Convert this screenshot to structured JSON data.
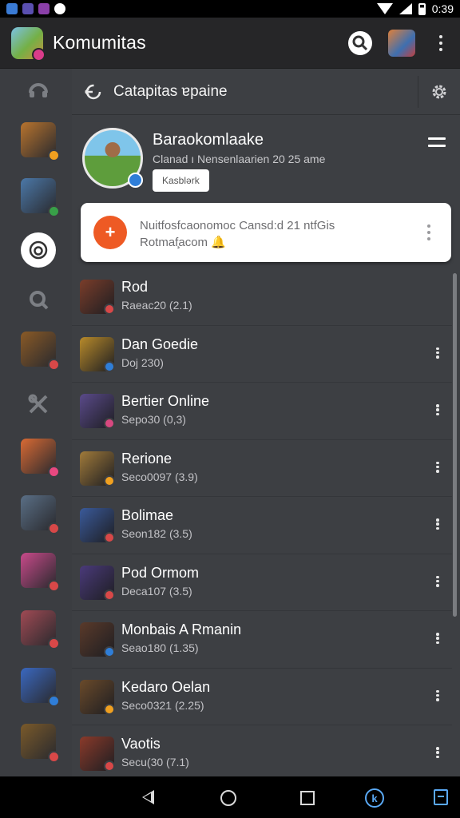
{
  "status_bar": {
    "time": "0:39",
    "icons": [
      "app-notification-icon",
      "game-notification-icon",
      "store-notification-icon",
      "cloud-icon",
      "wifi-icon",
      "signal-icon",
      "battery-icon"
    ]
  },
  "app_bar": {
    "title": "Komumitas",
    "icons": [
      "app-logo",
      "search-icon",
      "profile-thumbnail",
      "more-icon"
    ]
  },
  "subheader": {
    "title": "Catapitas ɐpaine",
    "icons": [
      "back-icon",
      "settings-icon"
    ]
  },
  "profile": {
    "name": "Baraokomlaake",
    "subtitle": "Clanad ı Nensenlaarien 20 25 ame",
    "button_label": "Kasblərk"
  },
  "notice": {
    "text_line1": "Nuitfosfcaonomoc Cansd:d 21 ntfGis",
    "text_line2": "Rotmaf̧acom 🔔",
    "icon_glyph": "+"
  },
  "rail": {
    "items": [
      {
        "icon": "headset-icon",
        "kind": "icon"
      },
      {
        "icon": "game-thumbnail",
        "kind": "game",
        "color": "#b8742e",
        "badge": "#f0a020"
      },
      {
        "icon": "game-thumbnail",
        "kind": "game",
        "color": "#4b78a8",
        "badge": "#38a048"
      },
      {
        "icon": "chat-icon",
        "kind": "selected"
      },
      {
        "icon": "search-icon",
        "kind": "icon"
      },
      {
        "icon": "game-thumbnail",
        "kind": "game",
        "color": "#8a5a26",
        "badge": "#d84848"
      },
      {
        "icon": "tools-icon",
        "kind": "icon"
      },
      {
        "icon": "game-thumbnail",
        "kind": "game",
        "color": "#d96a34",
        "badge": "#e84880"
      },
      {
        "icon": "game-thumbnail",
        "kind": "game",
        "color": "#5a6f86",
        "badge": "#d84848"
      },
      {
        "icon": "game-thumbnail",
        "kind": "game",
        "color": "#c84a8a",
        "badge": "#d84848"
      },
      {
        "icon": "game-thumbnail",
        "kind": "game",
        "color": "#a04a54",
        "badge": "#d84848"
      },
      {
        "icon": "game-thumbnail",
        "kind": "game",
        "color": "#3a68c0",
        "badge": "#2f7ed8"
      },
      {
        "icon": "game-thumbnail",
        "kind": "game",
        "color": "#7a5a2a",
        "badge": "#d84848"
      }
    ]
  },
  "list": {
    "rows": [
      {
        "title": "Rod",
        "subtitle": "Raeac20 (2.1)",
        "thumb_color": "#7a3d2a",
        "badge_color": "#d84848",
        "has_menu": false
      },
      {
        "title": "Dan Goedie",
        "subtitle": "Doj 230)",
        "thumb_color": "#b88a2a",
        "badge_color": "#2f7ed8",
        "has_menu": true
      },
      {
        "title": "Bertier Online",
        "subtitle": "Sepo30 (0,3)",
        "thumb_color": "#5a4a8a",
        "badge_color": "#d84880",
        "has_menu": true
      },
      {
        "title": "Rerione",
        "subtitle": "Seco0097 (3.9)",
        "thumb_color": "#a07a3a",
        "badge_color": "#f0a020",
        "has_menu": true
      },
      {
        "title": "Bolimae",
        "subtitle": "Seon182 (3.5)",
        "thumb_color": "#3a5a9a",
        "badge_color": "#d84848",
        "has_menu": true
      },
      {
        "title": "Pod Ormom",
        "subtitle": "Deca107 (3.5)",
        "thumb_color": "#4a3a7a",
        "badge_color": "#d84848",
        "has_menu": true
      },
      {
        "title": "Monbais A Rmanin",
        "subtitle": "Seao180 (1.35)",
        "thumb_color": "#5a3a2a",
        "badge_color": "#2f7ed8",
        "has_menu": true
      },
      {
        "title": "Kedaro Oelan",
        "subtitle": "Seco0321 (2.25)",
        "thumb_color": "#6a4a2a",
        "badge_color": "#f0a020",
        "has_menu": true
      },
      {
        "title": "Vaotis",
        "subtitle": "Secu(30 (7.1)",
        "thumb_color": "#8a3a2a",
        "badge_color": "#d84848",
        "has_menu": true
      }
    ]
  },
  "nav_bar": {
    "icons": [
      "back-triangle-icon",
      "home-circle-icon",
      "recents-square-icon",
      "assistant-icon",
      "share-icon"
    ]
  },
  "colors": {
    "rail_bg": "#3b3d41",
    "main_bg": "#3d3f43",
    "app_bar_bg": "#262628",
    "accent_orange": "#ee5a24",
    "nav_accent": "#5aa9f5"
  }
}
